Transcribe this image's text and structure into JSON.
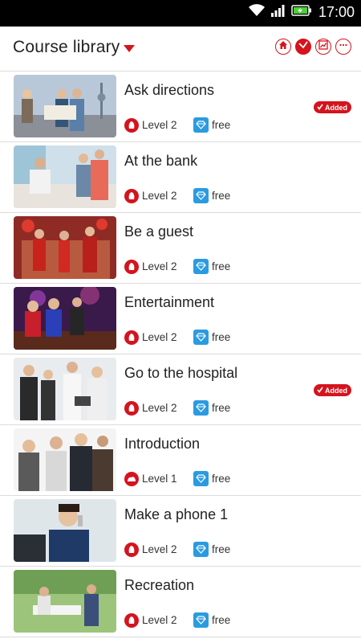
{
  "status_bar": {
    "time": "17:00",
    "icons": [
      "wifi-icon",
      "signal-icon",
      "battery-charging-icon"
    ]
  },
  "header": {
    "title": "Course library",
    "actions": [
      "home-icon",
      "swap-icon",
      "chart-icon",
      "more-icon"
    ]
  },
  "colors": {
    "accent": "#d4141e",
    "gem": "#2a9be0"
  },
  "courses": [
    {
      "title": "Ask directions",
      "level": "Level 2",
      "price": "free",
      "added": "Added"
    },
    {
      "title": "At the bank",
      "level": "Level 2",
      "price": "free",
      "added": ""
    },
    {
      "title": "Be a guest",
      "level": "Level 2",
      "price": "free",
      "added": ""
    },
    {
      "title": "Entertainment",
      "level": "Level 2",
      "price": "free",
      "added": ""
    },
    {
      "title": "Go to the hospital",
      "level": "Level 2",
      "price": "free",
      "added": "Added"
    },
    {
      "title": "Introduction",
      "level": "Level 1",
      "price": "free",
      "added": ""
    },
    {
      "title": "Make a phone 1",
      "level": "Level 2",
      "price": "free",
      "added": ""
    },
    {
      "title": "Recreation",
      "level": "Level 2",
      "price": "free",
      "added": ""
    }
  ]
}
